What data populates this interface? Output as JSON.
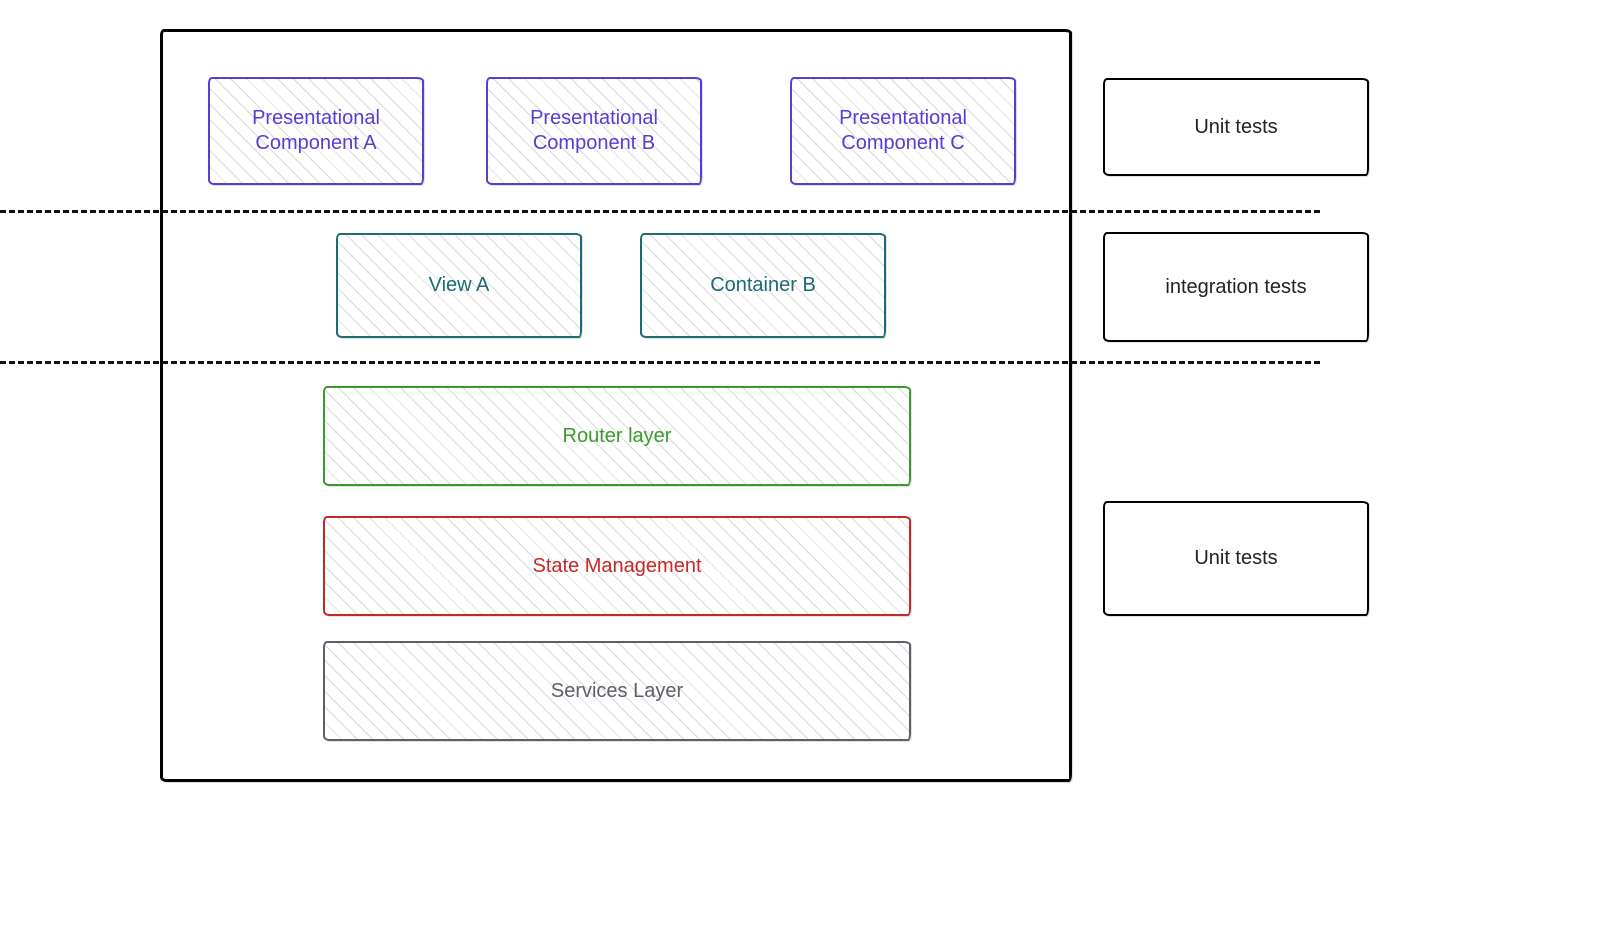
{
  "main_container": {
    "layers": {
      "presentational": {
        "a": "Presentational\nComponent A",
        "b": "Presentational\nComponent B",
        "c": "Presentational\nComponent C"
      },
      "views": {
        "view_a": "View A",
        "container_b": "Container B"
      },
      "router": "Router layer",
      "state": "State Management",
      "services": "Services Layer"
    }
  },
  "test_annotations": {
    "top": "Unit tests",
    "middle": "integration tests",
    "bottom": "Unit tests"
  },
  "colors": {
    "purple": "#5a3bd6",
    "teal": "#1a6b72",
    "green": "#3a9a2e",
    "red": "#c62828",
    "gray": "#5b6069",
    "black": "#000000"
  }
}
